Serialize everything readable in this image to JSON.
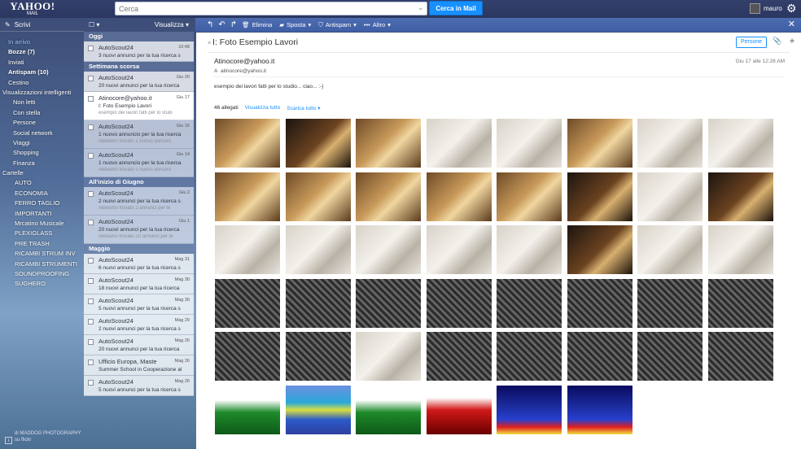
{
  "header": {
    "logo_top": "YAHOO!",
    "logo_bottom": "MAIL",
    "search_placeholder": "Cerca",
    "search_button": "Cerca in Mail",
    "user_name": "mauro"
  },
  "sidebar": {
    "compose": "Scrivi",
    "folders": [
      {
        "label": "In arrivo",
        "style": "active"
      },
      {
        "label": "Bozze (7)",
        "style": "bold"
      },
      {
        "label": "Inviati",
        "style": ""
      },
      {
        "label": "Antispam (10)",
        "style": "bold"
      },
      {
        "label": "Cestino",
        "style": ""
      },
      {
        "label": "Visualizzazioni intelligenti",
        "style": "sec"
      },
      {
        "label": "Non letti",
        "style": "sub"
      },
      {
        "label": "Con stella",
        "style": "sub"
      },
      {
        "label": "Persone",
        "style": "sub"
      },
      {
        "label": "Social network",
        "style": "sub"
      },
      {
        "label": "Viaggi",
        "style": "sub"
      },
      {
        "label": "Shopping",
        "style": "sub"
      },
      {
        "label": "Finanza",
        "style": "sub"
      },
      {
        "label": "Cartelle",
        "style": "sec"
      },
      {
        "label": "AUTO",
        "style": "cf"
      },
      {
        "label": "ECONOMIA",
        "style": "cf"
      },
      {
        "label": "FERRO TAGLIO",
        "style": "cf"
      },
      {
        "label": "IMPORTANTI",
        "style": "cf"
      },
      {
        "label": "Mrcatino Musicale",
        "style": "cf"
      },
      {
        "label": "PLEXIGLASS",
        "style": "cf"
      },
      {
        "label": "PRE TRASH",
        "style": "cf"
      },
      {
        "label": "RICAMBI STRUM INV",
        "style": "cf"
      },
      {
        "label": "RICAMBI STRUMENTI",
        "style": "cf"
      },
      {
        "label": "SOUNDPROOFING",
        "style": "cf"
      },
      {
        "label": "SUGHERO",
        "style": "cf"
      }
    ],
    "photo_credit_line1": "di MADDOG PHOTOGRAPHY",
    "photo_credit_line2": "su flickr"
  },
  "list": {
    "view_label": "Visualizza",
    "sections": [
      {
        "title": "Oggi",
        "messages": [
          {
            "from": "AutoScout24",
            "date": "10:48",
            "subject": "3 nuovi annunci per la tua ricerca s",
            "snippet": "",
            "state": ""
          }
        ]
      },
      {
        "title": "Settimana scorsa",
        "messages": [
          {
            "from": "AutoScout24",
            "date": "Giu 20",
            "subject": "20 nuovi annunci per la tua ricerca",
            "snippet": "",
            "state": ""
          },
          {
            "from": "Atinocore@yahoo.it",
            "date": "Giu 17",
            "subject": "I: Foto Esempio Lavori",
            "snippet": "esempio dei lavori fatti per lo studi",
            "state": "sel"
          },
          {
            "from": "AutoScout24",
            "date": "Giu 16",
            "subject": "1 nuovo annuncio per la tua ricerca",
            "snippet": "Abbiamo trovato 1 nuovo annunci",
            "state": "dim"
          },
          {
            "from": "AutoScout24",
            "date": "Giu 14",
            "subject": "1 nuovo annuncio per la tua ricerca",
            "snippet": "Abbiamo trovato 1 nuovo annunci",
            "state": "dim"
          }
        ]
      },
      {
        "title": "All'inizio di Giugno",
        "messages": [
          {
            "from": "AutoScout24",
            "date": "Giu 2",
            "subject": "2 nuovi annunci per la tua ricerca s",
            "snippet": "Abbiamo trovato 2 annunci per te",
            "state": "dim"
          },
          {
            "from": "AutoScout24",
            "date": "Giu 1",
            "subject": "20 nuovi annunci per la tua ricerca",
            "snippet": "Abbiamo trovato 20 annunci per te",
            "state": "dim"
          }
        ]
      },
      {
        "title": "Maggio",
        "messages": [
          {
            "from": "AutoScout24",
            "date": "Mag 31",
            "subject": "6 nuovi annunci per la tua ricerca s",
            "snippet": "",
            "state": ""
          },
          {
            "from": "AutoScout24",
            "date": "Mag 30",
            "subject": "18 nuovi annunci per la tua ricerca",
            "snippet": "",
            "state": ""
          },
          {
            "from": "AutoScout24",
            "date": "Mag 30",
            "subject": "5 nuovi annunci per la tua ricerca s",
            "snippet": "",
            "state": ""
          },
          {
            "from": "AutoScout24",
            "date": "Mag 29",
            "subject": "2 nuovi annunci per la tua ricerca s",
            "snippet": "",
            "state": ""
          },
          {
            "from": "AutoScout24",
            "date": "Mag 26",
            "subject": "20 nuovi annunci per la tua ricerca",
            "snippet": "",
            "state": ""
          },
          {
            "from": "Ufficio Europa, Maste",
            "date": "Mag 26",
            "subject": "Summer School in Cooperazione al",
            "snippet": "",
            "state": ""
          },
          {
            "from": "AutoScout24",
            "date": "Mag 26",
            "subject": "5 nuovi annunci per la tua ricerca s",
            "snippet": "",
            "state": ""
          }
        ]
      }
    ]
  },
  "toolbar": {
    "delete": "Elimina",
    "move": "Sposta",
    "spam": "Antispam",
    "more": "Altro"
  },
  "message": {
    "subject": "I: Foto Esempio Lavori",
    "persone_button": "Persone",
    "from": "Atinocore@yahoo.it",
    "to_prefix": "A",
    "to": "atinocore@yahoo.it",
    "date": "Giu 17 alle 12:28 AM",
    "body": "esempio dei lavori fatti per lo studio... ciao... :-)",
    "attachments_count": "46 allegati",
    "view_all": "Visualizza tutto",
    "download_all": "Scarica tutto"
  },
  "attachment_thumbs": [
    "wood",
    "dark",
    "wood",
    "light",
    "light",
    "wood",
    "light",
    "light",
    "wood",
    "wood",
    "wood",
    "wood",
    "wood",
    "dark",
    "light",
    "dark",
    "light",
    "light",
    "light",
    "light",
    "light",
    "dark",
    "light",
    "light",
    "foam",
    "foam",
    "foam",
    "foam",
    "foam",
    "foam",
    "foam",
    "foam",
    "foam",
    "foam",
    "light",
    "foam",
    "foam",
    "foam",
    "foam",
    "foam",
    "green",
    "heat",
    "green",
    "red",
    "spectro",
    "spectro"
  ],
  "colors": {
    "accent": "#188fff",
    "toolbar": "#3f5fa6",
    "header": "#2b3760"
  }
}
